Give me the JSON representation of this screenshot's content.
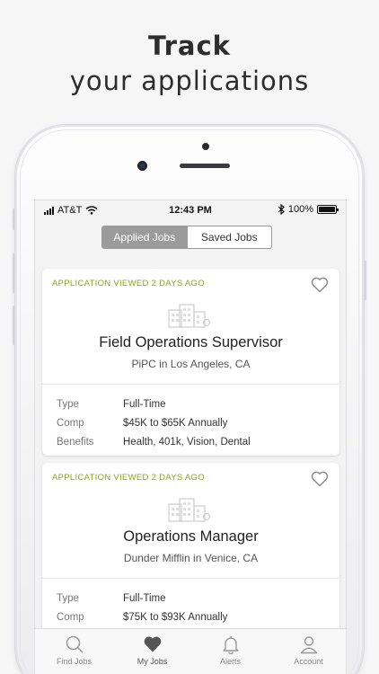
{
  "headline": {
    "line1": "Track",
    "line2": "your applications"
  },
  "status_bar": {
    "carrier": "AT&T",
    "time": "12:43 PM",
    "battery": "100%",
    "icons": [
      "signal-bars-icon",
      "wifi-icon",
      "bluetooth-icon",
      "battery-icon"
    ]
  },
  "segments": {
    "applied": "Applied Jobs",
    "saved": "Saved Jobs",
    "selected": "Applied Jobs"
  },
  "jobs": [
    {
      "status": "APPLICATION VIEWED 2 DAYS AGO",
      "title": "Field Operations Supervisor",
      "company": "PiPC in Los Angeles, CA",
      "details": [
        {
          "key": "Type",
          "value": "Full-Time"
        },
        {
          "key": "Comp",
          "value": "$45K to $65K Annually"
        },
        {
          "key": "Benefits",
          "value": "Health, 401k, Vision, Dental"
        }
      ]
    },
    {
      "status": "APPLICATION VIEWED 2 DAYS AGO",
      "title": "Operations Manager",
      "company": "Dunder Mifflin in Venice, CA",
      "details": [
        {
          "key": "Type",
          "value": "Full-Time"
        },
        {
          "key": "Comp",
          "value": "$75K to $93K Annually"
        }
      ]
    }
  ],
  "tabs": [
    {
      "label": "Find Jobs",
      "icon": "search-icon"
    },
    {
      "label": "My Jobs",
      "icon": "heart-icon"
    },
    {
      "label": "Alerts",
      "icon": "bell-icon"
    },
    {
      "label": "Account",
      "icon": "person-icon"
    }
  ],
  "colors": {
    "accent_green": "#8aa61a",
    "segment_active": "#9b9b9b",
    "background": "#f6f6f7"
  }
}
